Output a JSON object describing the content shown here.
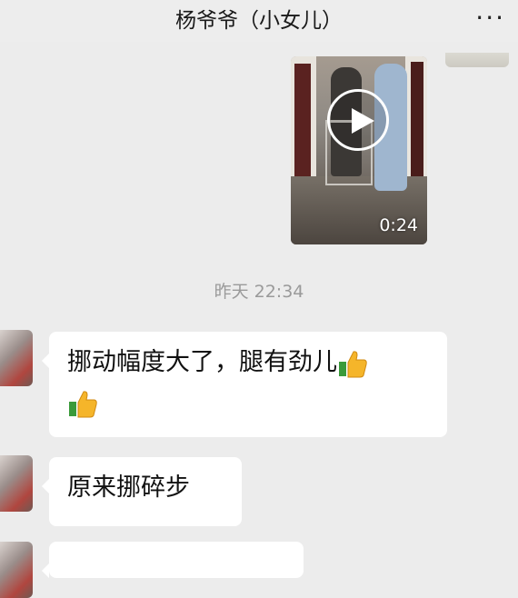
{
  "header": {
    "title": "杨爷爷（小女儿）",
    "more_label": "···"
  },
  "video_message": {
    "duration": "0:24"
  },
  "time_divider": "昨天 22:34",
  "messages": [
    {
      "text": "挪动幅度大了，腿有劲儿",
      "emoji": [
        "thumbs-up-icon",
        "thumbs-up-icon"
      ]
    },
    {
      "text": "原来挪碎步"
    }
  ],
  "colors": {
    "background": "#ececec",
    "bubble": "#ffffff",
    "timestamp": "#9a9a9a"
  }
}
